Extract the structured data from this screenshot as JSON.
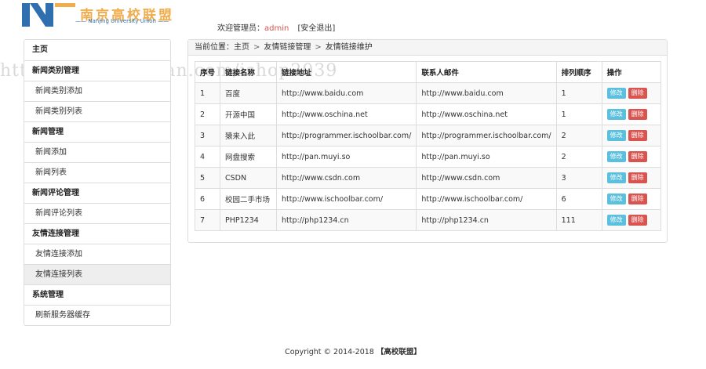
{
  "header": {
    "logo_title": "南京高校联盟",
    "logo_subtitle": "—— Nanjing University Union ——",
    "welcome_label": "欢迎管理员：",
    "admin_name": "admin",
    "logout_label": "[安全退出]"
  },
  "sidebar": {
    "items": [
      {
        "label": "主页",
        "kind": "header"
      },
      {
        "label": "新闻类别管理",
        "kind": "header"
      },
      {
        "label": "新闻类别添加",
        "kind": "link"
      },
      {
        "label": "新闻类别列表",
        "kind": "link"
      },
      {
        "label": "新闻管理",
        "kind": "header"
      },
      {
        "label": "新闻添加",
        "kind": "link"
      },
      {
        "label": "新闻列表",
        "kind": "link"
      },
      {
        "label": "新闻评论管理",
        "kind": "header"
      },
      {
        "label": "新闻评论列表",
        "kind": "link"
      },
      {
        "label": "友情连接管理",
        "kind": "header"
      },
      {
        "label": "友情连接添加",
        "kind": "link"
      },
      {
        "label": "友情连接列表",
        "kind": "link",
        "active": true
      },
      {
        "label": "系统管理",
        "kind": "header"
      },
      {
        "label": "刷新服务器缓存",
        "kind": "link"
      }
    ]
  },
  "breadcrumb": {
    "prefix": "当前位置：",
    "items": [
      "主页",
      "友情链接管理",
      "友情链接维护"
    ],
    "separator": ">"
  },
  "table": {
    "headers": [
      "序号",
      "链接名称",
      "链接地址",
      "联系人邮件",
      "排列顺序",
      "操作"
    ],
    "edit_label": "修改",
    "delete_label": "删除",
    "rows": [
      [
        "1",
        "百度",
        "http://www.baidu.com",
        "http://www.baidu.com",
        "1"
      ],
      [
        "2",
        "开源中国",
        "http://www.oschina.net",
        "http://www.oschina.net",
        "1"
      ],
      [
        "3",
        "猿来入此",
        "http://programmer.ischoolbar.com/",
        "http://programmer.ischoolbar.com/",
        "2"
      ],
      [
        "4",
        "网盘搜索",
        "http://pan.muyi.so",
        "http://pan.muyi.so",
        "2"
      ],
      [
        "5",
        "CSDN",
        "http://www.csdn.com",
        "http://www.csdn.com",
        "3"
      ],
      [
        "6",
        "校园二手市场",
        "http://www.ischoolbar.com/",
        "http://www.ischoolbar.com/",
        "6"
      ],
      [
        "7",
        "PHP1234",
        "http://php1234.cn",
        "http://php1234.cn",
        "111"
      ]
    ]
  },
  "watermark": "https://www.huzhan.com/ishop2039",
  "footer": {
    "copyright": "Copyright © 2014-2018",
    "brand": "【高校联盟】"
  },
  "colors": {
    "edit_button": "#5bc0de",
    "delete_button": "#d9534f",
    "admin_name": "#d9534f",
    "logo_title": "#f0ad4e",
    "logo_mark": "#2f6fb0"
  }
}
